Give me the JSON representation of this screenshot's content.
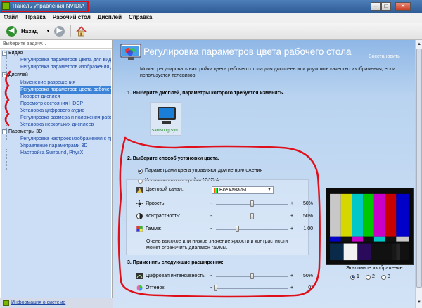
{
  "window": {
    "title": "Панель управления NVIDIA",
    "min": "–",
    "max": "□",
    "close": "✕",
    "accent": "#76b900"
  },
  "menu": [
    "Файл",
    "Правка",
    "Рабочий стол",
    "Дисплей",
    "Справка"
  ],
  "toolbar": {
    "back_label": "Назад",
    "back_icon": "◀",
    "forward_icon": "▶",
    "dropdown": "▼"
  },
  "left": {
    "task_prompt": "Выберите задачу...",
    "tree": [
      {
        "type": "cat",
        "label": "Видео"
      },
      {
        "type": "item",
        "label": "Регулировка параметров цвета для вид"
      },
      {
        "type": "item",
        "label": "Регулировка параметров изображения д"
      },
      {
        "type": "cat",
        "label": "Дисплей"
      },
      {
        "type": "item",
        "label": "Изменение разрешения"
      },
      {
        "type": "item",
        "label": "Регулировка параметров цвета рабочег",
        "selected": true
      },
      {
        "type": "item",
        "label": "Поворот дисплея"
      },
      {
        "type": "item",
        "label": "Просмотр состояния HDCP"
      },
      {
        "type": "item",
        "label": "Установка цифрового аудио"
      },
      {
        "type": "item",
        "label": "Регулировка размера и положения рабо"
      },
      {
        "type": "item",
        "label": "Установка нескольких дисплеев"
      },
      {
        "type": "cat",
        "label": "Параметры 3D"
      },
      {
        "type": "item",
        "label": "Регулировка настроек изображения с пр"
      },
      {
        "type": "item",
        "label": "Управление параметрами 3D"
      },
      {
        "type": "item",
        "label": "Настройка Surround, PhysX"
      }
    ],
    "sysinfo": "Информация о системе"
  },
  "page": {
    "title": "Регулировка параметров цвета рабочего стола",
    "restore": "Восстановить",
    "description": "Можно регулировать настройки цвета рабочего стола для дисплеев или улучшить качество изображения, если используется телевизор.",
    "section1": "1. Выберите дисплей, параметры которого требуется изменить.",
    "display_name": "Samsung Syn...",
    "section2": "2. Выберите способ установки цвета.",
    "radio_apps": "Параметрами цвета управляют другие приложения",
    "radio_nvidia": "Использовать настройки NVIDIA",
    "channel_label": "Цветовой канал:",
    "channel_value": "Все каналы",
    "sliders": [
      {
        "label": "Яркость:",
        "value": "50%",
        "level": 0.5
      },
      {
        "label": "Контрастность:",
        "value": "50%",
        "level": 0.5
      },
      {
        "label": "Гамма:",
        "value": "1.00",
        "level": 0.3
      }
    ],
    "note": "Очень высокое или низкое значение яркости и контрастности может ограничить диапазон гаммы.",
    "section3": "3. Применить следующие расширения:",
    "sliders2": [
      {
        "label": "Цифровая интенсивность:",
        "value": "50%",
        "level": 0.5
      },
      {
        "label": "Оттенок:",
        "value": "0°",
        "level": 0.0
      }
    ],
    "minus": "-",
    "plus": "+",
    "reference_caption": "Эталонное изображение:",
    "reference_options": [
      "1",
      "2",
      "3"
    ],
    "reference_selected": "1"
  }
}
